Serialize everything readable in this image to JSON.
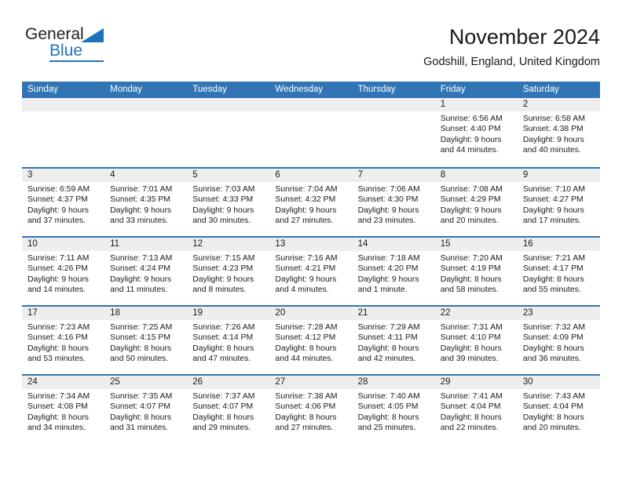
{
  "brand": {
    "name_part1": "General",
    "name_part2": "Blue",
    "triangle_icon": "triangle-icon",
    "accent_color": "#1e73be"
  },
  "header": {
    "title": "November 2024",
    "subtitle": "Godshill, England, United Kingdom"
  },
  "calendar": {
    "header_bg": "#3275b5",
    "day_band_bg": "#eeeeee",
    "weekdays": [
      "Sunday",
      "Monday",
      "Tuesday",
      "Wednesday",
      "Thursday",
      "Friday",
      "Saturday"
    ],
    "weeks": [
      [
        {
          "day": "",
          "lines": []
        },
        {
          "day": "",
          "lines": []
        },
        {
          "day": "",
          "lines": []
        },
        {
          "day": "",
          "lines": []
        },
        {
          "day": "",
          "lines": []
        },
        {
          "day": "1",
          "lines": [
            "Sunrise: 6:56 AM",
            "Sunset: 4:40 PM",
            "Daylight: 9 hours",
            "and 44 minutes."
          ]
        },
        {
          "day": "2",
          "lines": [
            "Sunrise: 6:58 AM",
            "Sunset: 4:38 PM",
            "Daylight: 9 hours",
            "and 40 minutes."
          ]
        }
      ],
      [
        {
          "day": "3",
          "lines": [
            "Sunrise: 6:59 AM",
            "Sunset: 4:37 PM",
            "Daylight: 9 hours",
            "and 37 minutes."
          ]
        },
        {
          "day": "4",
          "lines": [
            "Sunrise: 7:01 AM",
            "Sunset: 4:35 PM",
            "Daylight: 9 hours",
            "and 33 minutes."
          ]
        },
        {
          "day": "5",
          "lines": [
            "Sunrise: 7:03 AM",
            "Sunset: 4:33 PM",
            "Daylight: 9 hours",
            "and 30 minutes."
          ]
        },
        {
          "day": "6",
          "lines": [
            "Sunrise: 7:04 AM",
            "Sunset: 4:32 PM",
            "Daylight: 9 hours",
            "and 27 minutes."
          ]
        },
        {
          "day": "7",
          "lines": [
            "Sunrise: 7:06 AM",
            "Sunset: 4:30 PM",
            "Daylight: 9 hours",
            "and 23 minutes."
          ]
        },
        {
          "day": "8",
          "lines": [
            "Sunrise: 7:08 AM",
            "Sunset: 4:29 PM",
            "Daylight: 9 hours",
            "and 20 minutes."
          ]
        },
        {
          "day": "9",
          "lines": [
            "Sunrise: 7:10 AM",
            "Sunset: 4:27 PM",
            "Daylight: 9 hours",
            "and 17 minutes."
          ]
        }
      ],
      [
        {
          "day": "10",
          "lines": [
            "Sunrise: 7:11 AM",
            "Sunset: 4:26 PM",
            "Daylight: 9 hours",
            "and 14 minutes."
          ]
        },
        {
          "day": "11",
          "lines": [
            "Sunrise: 7:13 AM",
            "Sunset: 4:24 PM",
            "Daylight: 9 hours",
            "and 11 minutes."
          ]
        },
        {
          "day": "12",
          "lines": [
            "Sunrise: 7:15 AM",
            "Sunset: 4:23 PM",
            "Daylight: 9 hours",
            "and 8 minutes."
          ]
        },
        {
          "day": "13",
          "lines": [
            "Sunrise: 7:16 AM",
            "Sunset: 4:21 PM",
            "Daylight: 9 hours",
            "and 4 minutes."
          ]
        },
        {
          "day": "14",
          "lines": [
            "Sunrise: 7:18 AM",
            "Sunset: 4:20 PM",
            "Daylight: 9 hours",
            "and 1 minute."
          ]
        },
        {
          "day": "15",
          "lines": [
            "Sunrise: 7:20 AM",
            "Sunset: 4:19 PM",
            "Daylight: 8 hours",
            "and 58 minutes."
          ]
        },
        {
          "day": "16",
          "lines": [
            "Sunrise: 7:21 AM",
            "Sunset: 4:17 PM",
            "Daylight: 8 hours",
            "and 55 minutes."
          ]
        }
      ],
      [
        {
          "day": "17",
          "lines": [
            "Sunrise: 7:23 AM",
            "Sunset: 4:16 PM",
            "Daylight: 8 hours",
            "and 53 minutes."
          ]
        },
        {
          "day": "18",
          "lines": [
            "Sunrise: 7:25 AM",
            "Sunset: 4:15 PM",
            "Daylight: 8 hours",
            "and 50 minutes."
          ]
        },
        {
          "day": "19",
          "lines": [
            "Sunrise: 7:26 AM",
            "Sunset: 4:14 PM",
            "Daylight: 8 hours",
            "and 47 minutes."
          ]
        },
        {
          "day": "20",
          "lines": [
            "Sunrise: 7:28 AM",
            "Sunset: 4:12 PM",
            "Daylight: 8 hours",
            "and 44 minutes."
          ]
        },
        {
          "day": "21",
          "lines": [
            "Sunrise: 7:29 AM",
            "Sunset: 4:11 PM",
            "Daylight: 8 hours",
            "and 42 minutes."
          ]
        },
        {
          "day": "22",
          "lines": [
            "Sunrise: 7:31 AM",
            "Sunset: 4:10 PM",
            "Daylight: 8 hours",
            "and 39 minutes."
          ]
        },
        {
          "day": "23",
          "lines": [
            "Sunrise: 7:32 AM",
            "Sunset: 4:09 PM",
            "Daylight: 8 hours",
            "and 36 minutes."
          ]
        }
      ],
      [
        {
          "day": "24",
          "lines": [
            "Sunrise: 7:34 AM",
            "Sunset: 4:08 PM",
            "Daylight: 8 hours",
            "and 34 minutes."
          ]
        },
        {
          "day": "25",
          "lines": [
            "Sunrise: 7:35 AM",
            "Sunset: 4:07 PM",
            "Daylight: 8 hours",
            "and 31 minutes."
          ]
        },
        {
          "day": "26",
          "lines": [
            "Sunrise: 7:37 AM",
            "Sunset: 4:07 PM",
            "Daylight: 8 hours",
            "and 29 minutes."
          ]
        },
        {
          "day": "27",
          "lines": [
            "Sunrise: 7:38 AM",
            "Sunset: 4:06 PM",
            "Daylight: 8 hours",
            "and 27 minutes."
          ]
        },
        {
          "day": "28",
          "lines": [
            "Sunrise: 7:40 AM",
            "Sunset: 4:05 PM",
            "Daylight: 8 hours",
            "and 25 minutes."
          ]
        },
        {
          "day": "29",
          "lines": [
            "Sunrise: 7:41 AM",
            "Sunset: 4:04 PM",
            "Daylight: 8 hours",
            "and 22 minutes."
          ]
        },
        {
          "day": "30",
          "lines": [
            "Sunrise: 7:43 AM",
            "Sunset: 4:04 PM",
            "Daylight: 8 hours",
            "and 20 minutes."
          ]
        }
      ]
    ]
  }
}
